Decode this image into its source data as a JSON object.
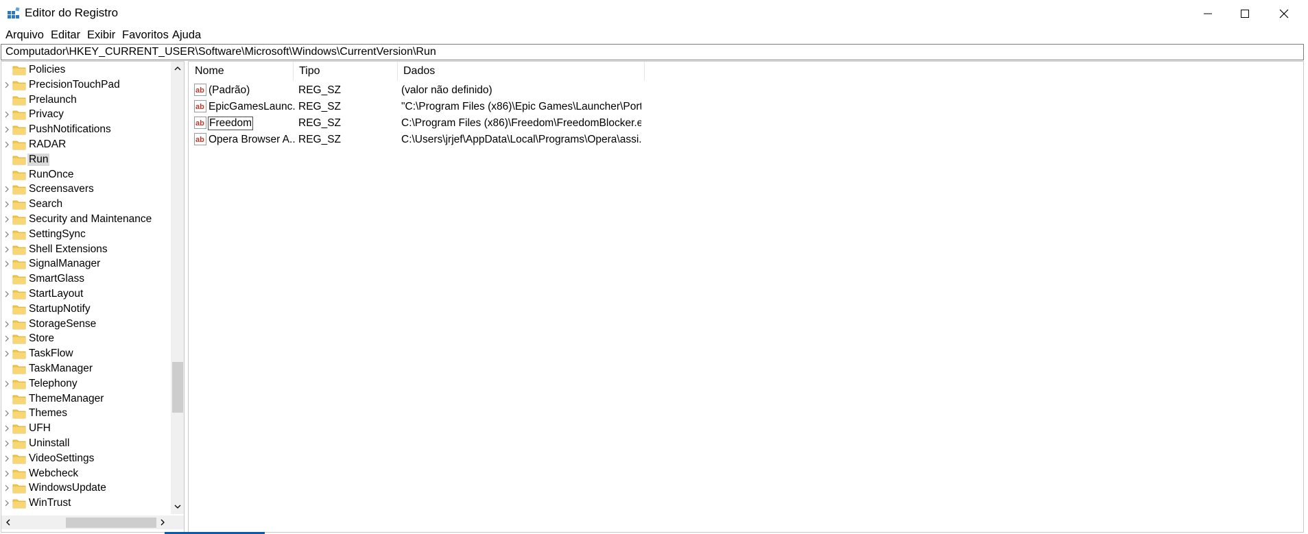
{
  "window": {
    "title": "Editor do Registro",
    "accent": "#0078d7"
  },
  "controls": {
    "minimize_icon": "minimize-icon",
    "maximize_icon": "maximize-icon",
    "close_icon": "close-icon"
  },
  "menu": {
    "items": [
      "Arquivo",
      "Editar",
      "Exibir",
      "Favoritos",
      "Ajuda"
    ]
  },
  "address": {
    "path": "Computador\\HKEY_CURRENT_USER\\Software\\Microsoft\\Windows\\CurrentVersion\\Run"
  },
  "tree": {
    "items": [
      {
        "label": "Policies",
        "expandable": false
      },
      {
        "label": "PrecisionTouchPad",
        "expandable": true
      },
      {
        "label": "Prelaunch",
        "expandable": false
      },
      {
        "label": "Privacy",
        "expandable": true
      },
      {
        "label": "PushNotifications",
        "expandable": true
      },
      {
        "label": "RADAR",
        "expandable": true
      },
      {
        "label": "Run",
        "expandable": false,
        "selected": true
      },
      {
        "label": "RunOnce",
        "expandable": false
      },
      {
        "label": "Screensavers",
        "expandable": true
      },
      {
        "label": "Search",
        "expandable": true
      },
      {
        "label": "Security and Maintenance",
        "expandable": true
      },
      {
        "label": "SettingSync",
        "expandable": true
      },
      {
        "label": "Shell Extensions",
        "expandable": true
      },
      {
        "label": "SignalManager",
        "expandable": true
      },
      {
        "label": "SmartGlass",
        "expandable": false
      },
      {
        "label": "StartLayout",
        "expandable": true
      },
      {
        "label": "StartupNotify",
        "expandable": false
      },
      {
        "label": "StorageSense",
        "expandable": true
      },
      {
        "label": "Store",
        "expandable": true
      },
      {
        "label": "TaskFlow",
        "expandable": true
      },
      {
        "label": "TaskManager",
        "expandable": false
      },
      {
        "label": "Telephony",
        "expandable": true
      },
      {
        "label": "ThemeManager",
        "expandable": false
      },
      {
        "label": "Themes",
        "expandable": true
      },
      {
        "label": "UFH",
        "expandable": true
      },
      {
        "label": "Uninstall",
        "expandable": true
      },
      {
        "label": "VideoSettings",
        "expandable": true
      },
      {
        "label": "Webcheck",
        "expandable": true
      },
      {
        "label": "WindowsUpdate",
        "expandable": true
      },
      {
        "label": "WinTrust",
        "expandable": true
      }
    ]
  },
  "list": {
    "headers": {
      "name": "Nome",
      "type": "Tipo",
      "data": "Dados"
    },
    "rows": [
      {
        "name": "(Padrão)",
        "type": "REG_SZ",
        "data": "(valor não definido)"
      },
      {
        "name": "EpicGamesLaunc...",
        "type": "REG_SZ",
        "data": "\"C:\\Program Files (x86)\\Epic Games\\Launcher\\Porta..."
      },
      {
        "name": "Freedom",
        "type": "REG_SZ",
        "data": "C:\\Program Files (x86)\\Freedom\\FreedomBlocker.e...",
        "focused": true
      },
      {
        "name": "Opera Browser A...",
        "type": "REG_SZ",
        "data": "C:\\Users\\jrjef\\AppData\\Local\\Programs\\Opera\\assi..."
      }
    ]
  }
}
